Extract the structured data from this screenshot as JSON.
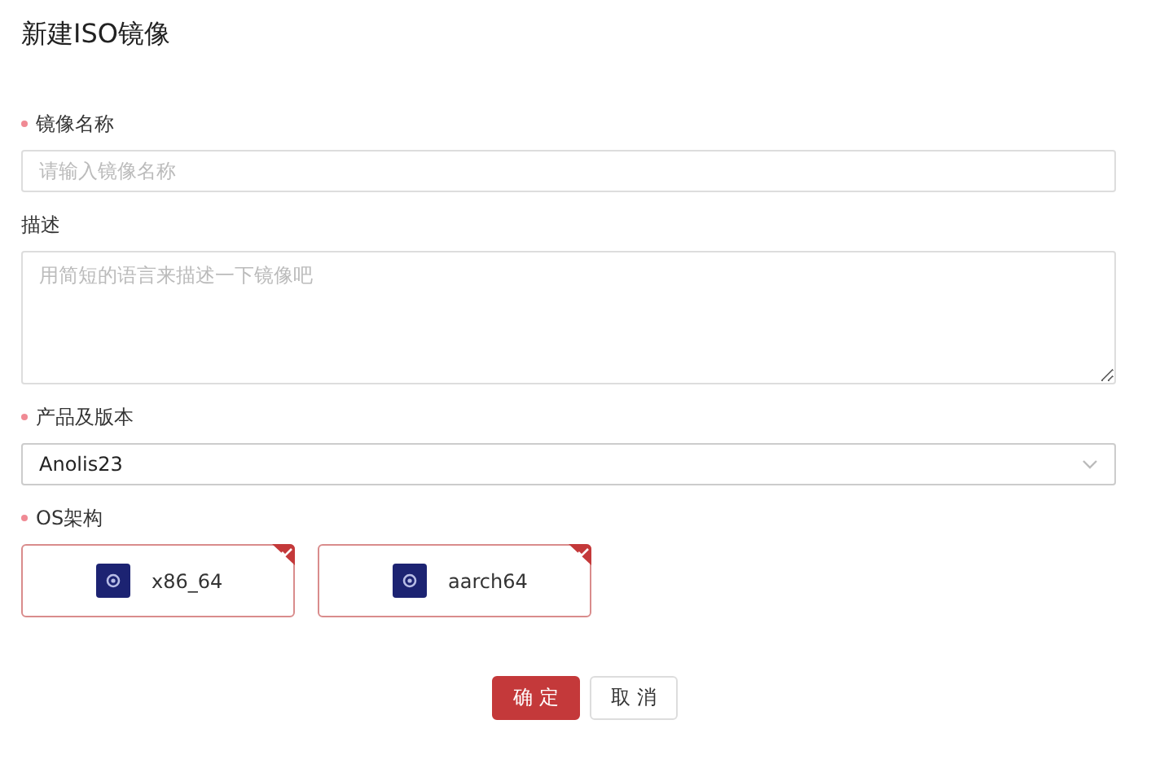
{
  "title": "新建ISO镜像",
  "fields": [
    {
      "kind": "input",
      "label": "镜像名称",
      "required": true,
      "placeholder": "请输入镜像名称"
    },
    {
      "kind": "textarea",
      "label": "描述",
      "required": false,
      "placeholder": "用简短的语言来描述一下镜像吧"
    },
    {
      "kind": "select",
      "label": "产品及版本",
      "required": true,
      "value": "Anolis23"
    },
    {
      "kind": "cards",
      "label": "OS架构",
      "required": true,
      "options": [
        {
          "label": "x86_64",
          "selected": true
        },
        {
          "label": "aarch64",
          "selected": true
        }
      ]
    }
  ],
  "buttons": [
    {
      "label": "确 定",
      "kind": "primary"
    },
    {
      "label": "取 消",
      "kind": "default"
    }
  ]
}
